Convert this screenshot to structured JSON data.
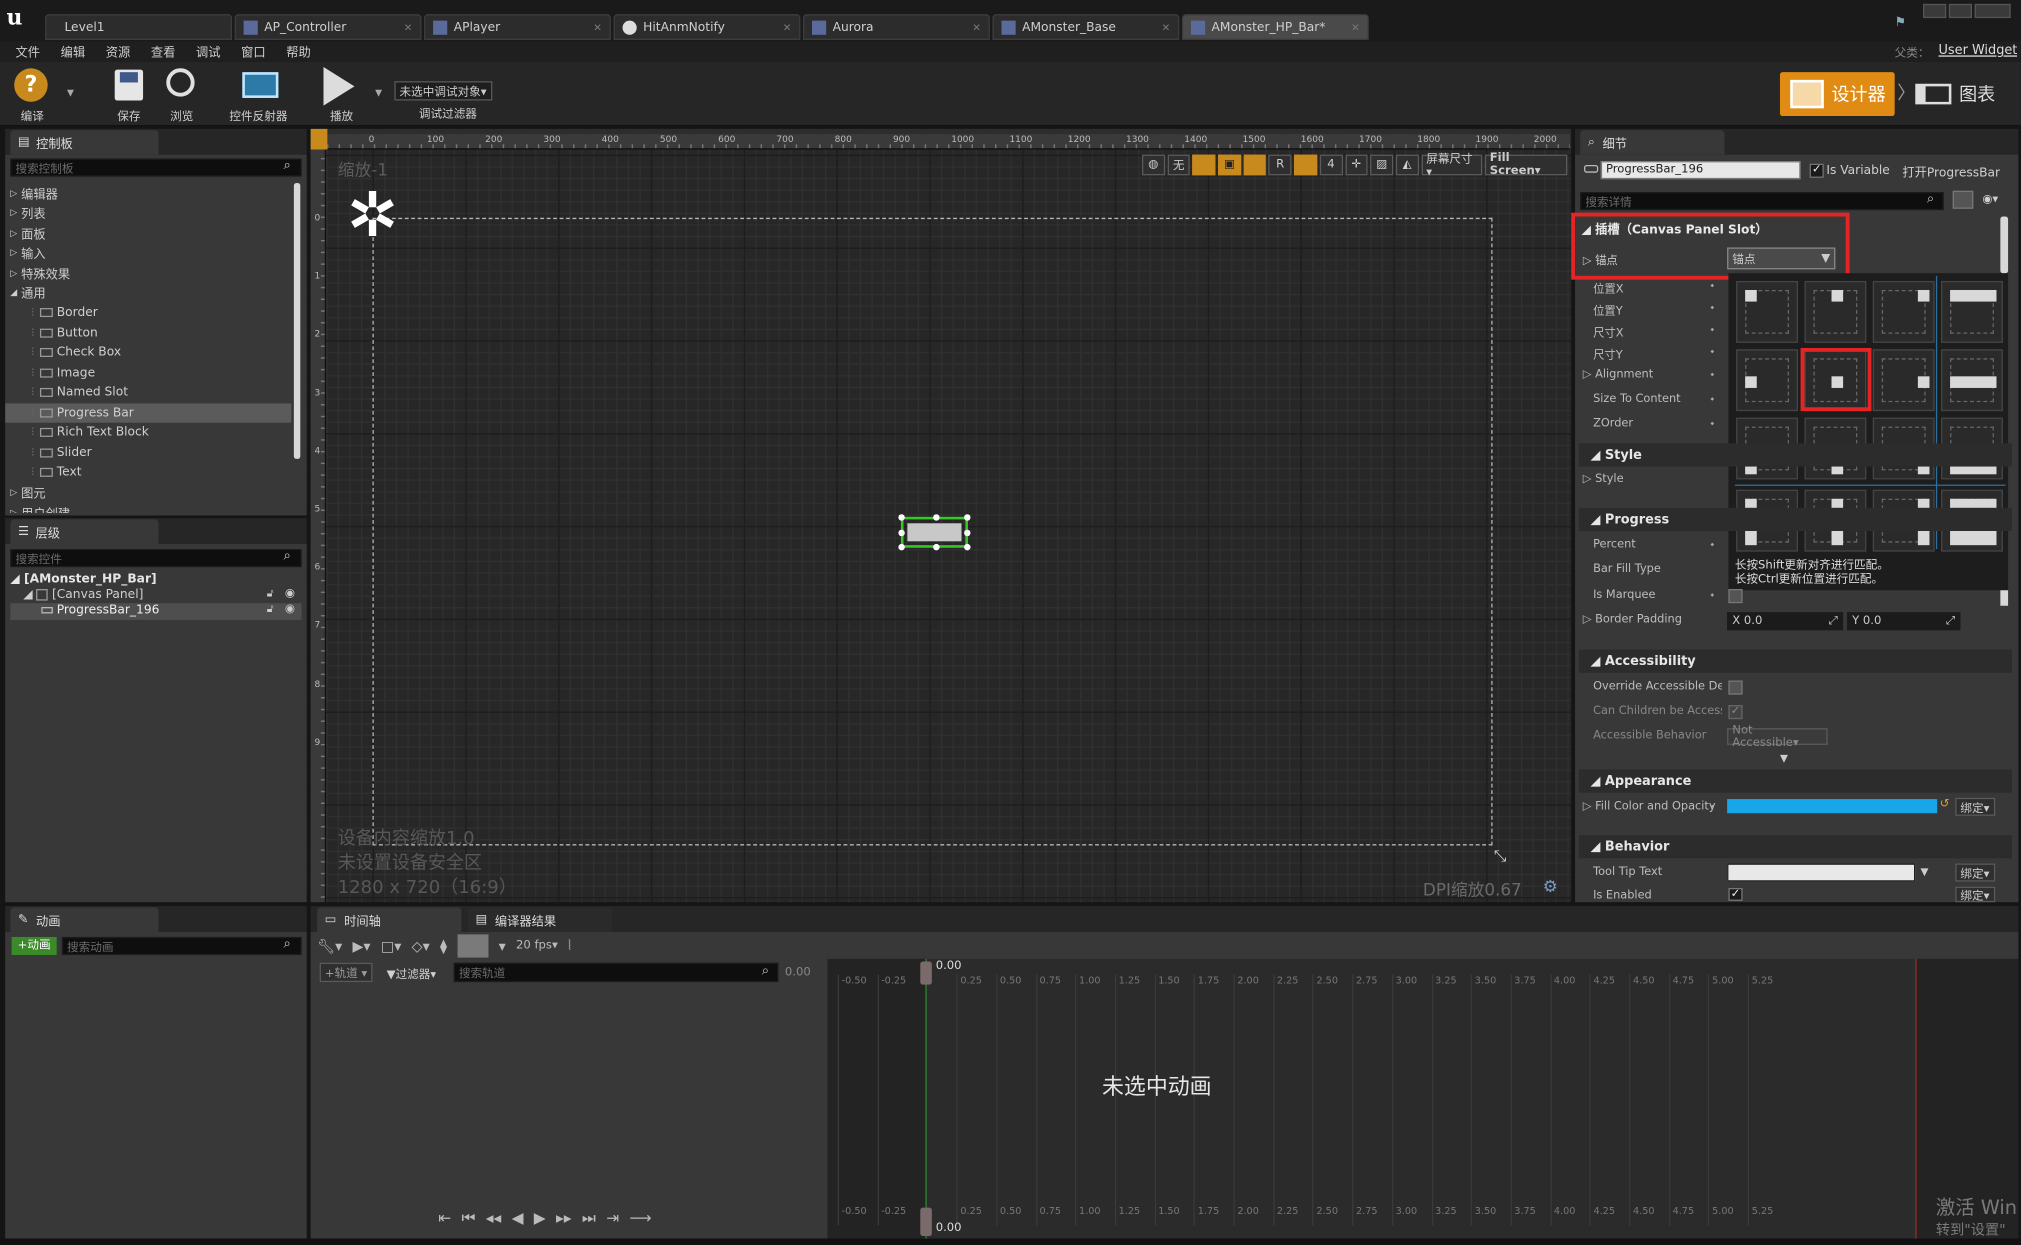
{
  "tabs": [
    {
      "label": "Level1",
      "active": false
    },
    {
      "label": "AP_Controller",
      "active": false
    },
    {
      "label": "APlayer",
      "active": false
    },
    {
      "label": "HitAnmNotify",
      "active": false
    },
    {
      "label": "Aurora",
      "active": false
    },
    {
      "label": "AMonster_Base",
      "active": false
    },
    {
      "label": "AMonster_HP_Bar*",
      "active": true
    }
  ],
  "parent": {
    "label": "父类：",
    "value": "User Widget"
  },
  "menu": [
    "文件",
    "编辑",
    "资源",
    "查看",
    "调试",
    "窗口",
    "帮助"
  ],
  "toolbar": {
    "compile": "编译",
    "save": "保存",
    "browse": "浏览",
    "reflector": "控件反射器",
    "play": "播放",
    "debug_object": "未选中调试对象▾",
    "debug_filter": "调试过滤器",
    "designer": "设计器",
    "graph": "图表"
  },
  "palette": {
    "tab": "控制板",
    "search": "搜索控制板",
    "categories": [
      {
        "label": "编辑器",
        "open": false
      },
      {
        "label": "列表",
        "open": false
      },
      {
        "label": "面板",
        "open": false
      },
      {
        "label": "输入",
        "open": false
      },
      {
        "label": "特殊效果",
        "open": false
      },
      {
        "label": "通用",
        "open": true
      }
    ],
    "items": [
      {
        "label": "Border",
        "selected": false
      },
      {
        "label": "Button",
        "selected": false
      },
      {
        "label": "Check Box",
        "selected": false
      },
      {
        "label": "Image",
        "selected": false
      },
      {
        "label": "Named Slot",
        "selected": false
      },
      {
        "label": "Progress Bar",
        "selected": true
      },
      {
        "label": "Rich Text Block",
        "selected": false
      },
      {
        "label": "Slider",
        "selected": false
      },
      {
        "label": "Text",
        "selected": false
      }
    ],
    "after": [
      "图元",
      "用户创建"
    ]
  },
  "hierarchy": {
    "tab": "层级",
    "search": "搜索控件",
    "root": "[AMonster_HP_Bar]",
    "canvas": "[Canvas Panel]",
    "item": "ProgressBar_196"
  },
  "canvas": {
    "zoom": "缩放-1",
    "ruler": [
      "0",
      "100",
      "200",
      "300",
      "400",
      "500",
      "600",
      "700",
      "800",
      "900",
      "1000",
      "1100",
      "1200",
      "1300",
      "1400",
      "1500",
      "1600",
      "1700",
      "1800",
      "1900",
      "2000"
    ],
    "vruler": [
      "0",
      "1",
      "2",
      "3",
      "4",
      "5",
      "6",
      "7",
      "8",
      "9"
    ],
    "info1": "设备内容缩放1.0",
    "info2": "未设置设备安全区",
    "info3": "1280 x 720（16:9）",
    "dpi": "DPI缩放0.67",
    "tool_none": "无",
    "tool_r": "R",
    "tool_4": "4",
    "screen_size": "屏幕尺寸▾",
    "fill_screen": "Fill Screen▾"
  },
  "details": {
    "tab": "细节",
    "name": "ProgressBar_196",
    "is_variable": "Is Variable",
    "open": "打开ProgressBar",
    "search": "搜索详情",
    "slot_header": "插槽（Canvas Panel Slot）",
    "anchor_label": "锚点",
    "anchor_value": "锚点",
    "slot_props": [
      "位置X",
      "位置Y",
      "尺寸X",
      "尺寸Y",
      "Alignment",
      "Size To Content",
      "ZOrder"
    ],
    "style_header": "Style",
    "style_prop": "Style",
    "progress_header": "Progress",
    "progress_props": [
      "Percent",
      "Bar Fill Type",
      "Is Marquee",
      "Border Padding"
    ],
    "border_x": "X  0.0",
    "border_y": "Y  0.0",
    "hint1": "长按Shift更新对齐进行匹配。",
    "hint2": "长按Ctrl更新位置进行匹配。",
    "access_header": "Accessibility",
    "access_props": [
      "Override Accessible Defau",
      "Can Children be Accessibl",
      "Accessible Behavior"
    ],
    "not_accessible": "Not Accessible▾",
    "appearance_header": "Appearance",
    "fill_prop": "Fill Color and Opacity",
    "bind": "绑定▾",
    "behavior_header": "Behavior",
    "behavior_props": [
      "Tool Tip Text",
      "Is Enabled"
    ],
    "fill_color": "#17a6e8"
  },
  "animation": {
    "tab": "动画",
    "add": "+动画",
    "search": "搜索动画"
  },
  "timeline": {
    "tab": "时间轴",
    "compiler_tab": "编译器结果",
    "fps": "20 fps▾",
    "track": "+轨道 ▾",
    "filter": "▼过滤器▾",
    "search": "搜索轨道",
    "time": "0.00",
    "scrub": "0.00",
    "bottom_time": "0.00",
    "empty": "未选中动画",
    "ticks": [
      "-0.50",
      "-0.25",
      "0.25",
      "0.50",
      "0.75",
      "1.00",
      "1.25",
      "1.50",
      "1.75",
      "2.00",
      "2.25",
      "2.50",
      "2.75",
      "3.00",
      "3.25",
      "3.50",
      "3.75",
      "4.00",
      "4.25",
      "4.50",
      "4.75",
      "5.00",
      "5.25"
    ]
  },
  "watermark1": "激活 Win",
  "watermark2": "转到\"设置\""
}
